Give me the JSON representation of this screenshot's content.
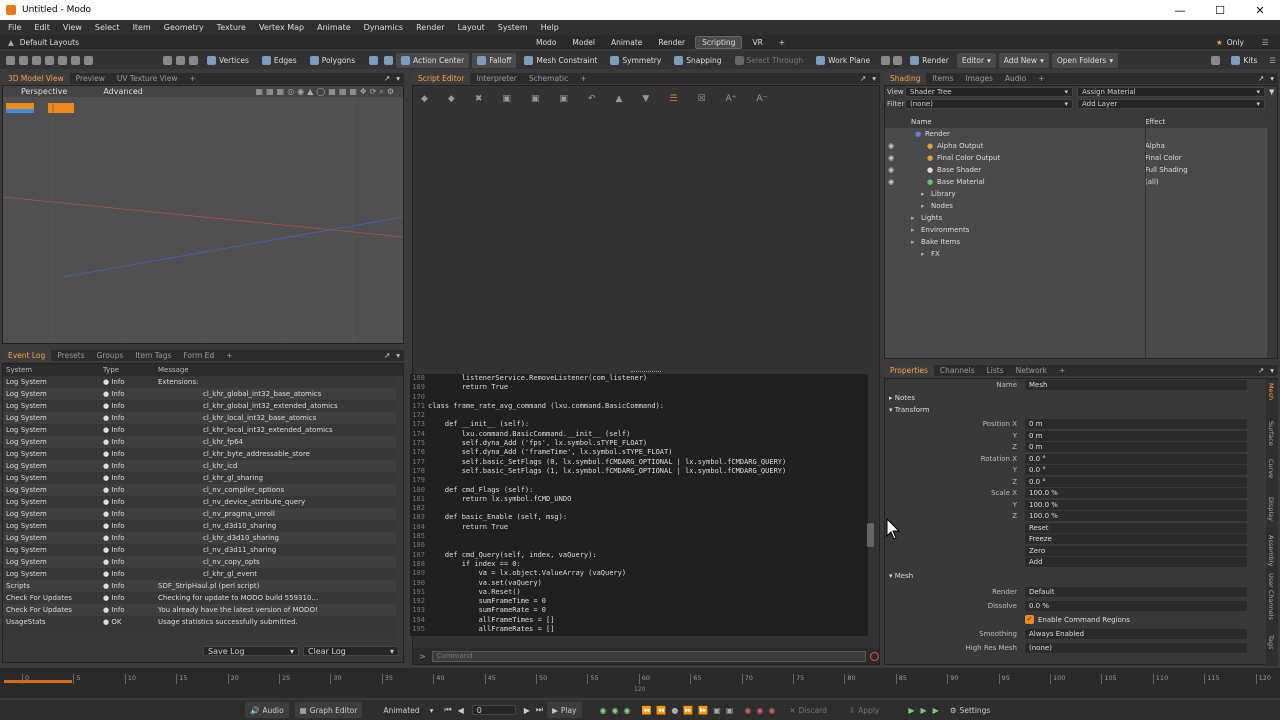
{
  "window": {
    "title": "Untitled - Modo"
  },
  "menu": [
    "File",
    "Edit",
    "View",
    "Select",
    "Item",
    "Geometry",
    "Texture",
    "Vertex Map",
    "Animate",
    "Dynamics",
    "Render",
    "Layout",
    "System",
    "Help"
  ],
  "layout_label": "Default Layouts",
  "modes": [
    "Modo",
    "Model",
    "Animate",
    "Render",
    "Scripting",
    "VR",
    "+"
  ],
  "active_mode": "Scripting",
  "only_label": "Only",
  "toolbar": {
    "vertices": "Vertices",
    "edges": "Edges",
    "polygons": "Polygons",
    "action_center": "Action Center",
    "falloff": "Falloff",
    "mesh_constraint": "Mesh Constraint",
    "symmetry": "Symmetry",
    "snapping": "Snapping",
    "select_through": "Select Through",
    "work_plane": "Work Plane",
    "render": "Render",
    "editor": "Editor",
    "add_new": "Add New",
    "open_folders": "Open Folders",
    "kits": "Kits"
  },
  "viewport": {
    "tabs": [
      "3D Model View",
      "Preview",
      "UV Texture View",
      "+"
    ],
    "perspective": "Perspective",
    "advanced": "Advanced"
  },
  "eventlog": {
    "tabs": [
      "Event Log",
      "Presets",
      "Groups",
      "Item Tags",
      "Form Ed",
      "+"
    ],
    "headers": [
      "System",
      "Type",
      "Message"
    ],
    "rows": [
      [
        "Log System",
        "Info",
        "Extensions:"
      ],
      [
        "Log System",
        "Info",
        "cl_khr_global_int32_base_atomics"
      ],
      [
        "Log System",
        "Info",
        "cl_khr_global_int32_extended_atomics"
      ],
      [
        "Log System",
        "Info",
        "cl_khr_local_int32_base_atomics"
      ],
      [
        "Log System",
        "Info",
        "cl_khr_local_int32_extended_atomics"
      ],
      [
        "Log System",
        "Info",
        "cl_khr_fp64"
      ],
      [
        "Log System",
        "Info",
        "cl_khr_byte_addressable_store"
      ],
      [
        "Log System",
        "Info",
        "cl_khr_icd"
      ],
      [
        "Log System",
        "Info",
        "cl_khr_gl_sharing"
      ],
      [
        "Log System",
        "Info",
        "cl_nv_compiler_options"
      ],
      [
        "Log System",
        "Info",
        "cl_nv_device_attribute_query"
      ],
      [
        "Log System",
        "Info",
        "cl_nv_pragma_unroll"
      ],
      [
        "Log System",
        "Info",
        "cl_nv_d3d10_sharing"
      ],
      [
        "Log System",
        "Info",
        "cl_khr_d3d10_sharing"
      ],
      [
        "Log System",
        "Info",
        "cl_nv_d3d11_sharing"
      ],
      [
        "Log System",
        "Info",
        "cl_nv_copy_opts"
      ],
      [
        "Log System",
        "Info",
        "cl_khr_gl_event"
      ],
      [
        "Scripts",
        "Info",
        "SDF_StripHaul.pl  (perl script)"
      ],
      [
        "Check For Updates",
        "Info",
        "Checking for update to MODO build 559310..."
      ],
      [
        "Check For Updates",
        "Info",
        "You already have the latest version of MODO!"
      ],
      [
        "UsageStats",
        "OK",
        "Usage statistics successfully submitted."
      ]
    ],
    "save_log": "Save Log",
    "clear_log": "Clear Log"
  },
  "script_editor": {
    "tabs": [
      "Script Editor",
      "Interpreter",
      "Schematic",
      "+"
    ],
    "command_placeholder": "Command",
    "lines": [
      [
        "168",
        "        listenerService.RemoveListener(com_listener)"
      ],
      [
        "169",
        "        return True"
      ],
      [
        "170",
        ""
      ],
      [
        "171",
        "class frame_rate_avg_command (lxu.command.BasicCommand):"
      ],
      [
        "172",
        ""
      ],
      [
        "173",
        "    def __init__ (self):"
      ],
      [
        "174",
        "        lxu.command.BasicCommand.__init__ (self)"
      ],
      [
        "175",
        "        self.dyna_Add ('fps', lx.symbol.sTYPE_FLOAT)"
      ],
      [
        "176",
        "        self.dyna_Add ('frameTime', lx.symbol.sTYPE_FLOAT)"
      ],
      [
        "177",
        "        self.basic_SetFlags (0, lx.symbol.fCMDARG_OPTIONAL | lx.symbol.fCMDARG_QUERY)"
      ],
      [
        "178",
        "        self.basic_SetFlags (1, lx.symbol.fCMDARG_OPTIONAL | lx.symbol.fCMDARG_QUERY)"
      ],
      [
        "179",
        ""
      ],
      [
        "180",
        "    def cmd_Flags (self):"
      ],
      [
        "181",
        "        return lx.symbol.fCMD_UNDO"
      ],
      [
        "182",
        ""
      ],
      [
        "183",
        "    def basic_Enable (self, msg):"
      ],
      [
        "184",
        "        return True"
      ],
      [
        "185",
        ""
      ],
      [
        "186",
        ""
      ],
      [
        "187",
        "    def cmd_Query(self, index, vaQuery):"
      ],
      [
        "188",
        "        if index == 0:"
      ],
      [
        "189",
        "            va = lx.object.ValueArray (vaQuery)"
      ],
      [
        "190",
        "            va.set(vaQuery)"
      ],
      [
        "191",
        "            va.Reset()"
      ],
      [
        "192",
        "            sumFrameTime = 0"
      ],
      [
        "193",
        "            sumFrameRate = 0"
      ],
      [
        "194",
        "            allFrameTimes = []"
      ],
      [
        "195",
        "            allFrameRates = []"
      ]
    ]
  },
  "shading": {
    "tabs": [
      "Shading",
      "Items",
      "Images",
      "Audio",
      "+"
    ],
    "view_label": "View",
    "view_value": "Shader Tree",
    "assign_material": "Assign Material",
    "filter_label": "Filter",
    "filter_value": "(none)",
    "add_layer": "Add Layer",
    "col_name": "Name",
    "col_effect": "Effect",
    "tree": [
      {
        "name": "Render",
        "effect": ""
      },
      {
        "name": "Alpha Output",
        "effect": "Alpha"
      },
      {
        "name": "Final Color Output",
        "effect": "Final Color"
      },
      {
        "name": "Base Shader",
        "effect": "Full Shading"
      },
      {
        "name": "Base Material",
        "effect": "(all)"
      },
      {
        "name": "Library",
        "effect": ""
      },
      {
        "name": "Nodes",
        "effect": ""
      },
      {
        "name": "Lights",
        "effect": ""
      },
      {
        "name": "Environments",
        "effect": ""
      },
      {
        "name": "Bake Items",
        "effect": ""
      },
      {
        "name": "FX",
        "effect": ""
      }
    ]
  },
  "properties": {
    "tabs": [
      "Properties",
      "Channels",
      "Lists",
      "Network",
      "+"
    ],
    "name_label": "Name",
    "name_value": "Mesh",
    "notes": "Notes",
    "transform": "Transform",
    "position_label": "Position X",
    "rotation_label": "Rotation X",
    "scale_label": "Scale X",
    "y": "Y",
    "z": "Z",
    "pos": [
      "0 m",
      "0 m",
      "0 m"
    ],
    "rot": [
      "0.0 °",
      "0.0 °",
      "0.0 °"
    ],
    "scale": [
      "100.0 %",
      "100.0 %",
      "100.0 %"
    ],
    "reset": "Reset",
    "freeze": "Freeze",
    "zero": "Zero",
    "add": "Add",
    "mesh": "Mesh",
    "render_label": "Render",
    "render_value": "Default",
    "dissolve_label": "Dissolve",
    "dissolve_value": "0.0 %",
    "enable_cmd": "Enable Command Regions",
    "smoothing_label": "Smoothing",
    "smoothing_value": "Always Enabled",
    "hires_label": "High Res Mesh",
    "hires_value": "(none)",
    "side_tabs": [
      "Mesh",
      "Surface",
      "Curve",
      "Display",
      "Assembly",
      "User Channels",
      "Tags"
    ]
  },
  "timeline": {
    "ticks": [
      "0",
      "5",
      "10",
      "15",
      "20",
      "25",
      "30",
      "35",
      "40",
      "45",
      "50",
      "55",
      "60",
      "65",
      "70",
      "75",
      "80",
      "85",
      "90",
      "95",
      "100",
      "105",
      "110",
      "115",
      "120"
    ],
    "mid": "120"
  },
  "transport": {
    "audio": "Audio",
    "graph_editor": "Graph Editor",
    "animated": "Animated",
    "frame": "0",
    "play": "Play",
    "discard": "Discard",
    "apply": "Apply",
    "settings": "Settings"
  }
}
